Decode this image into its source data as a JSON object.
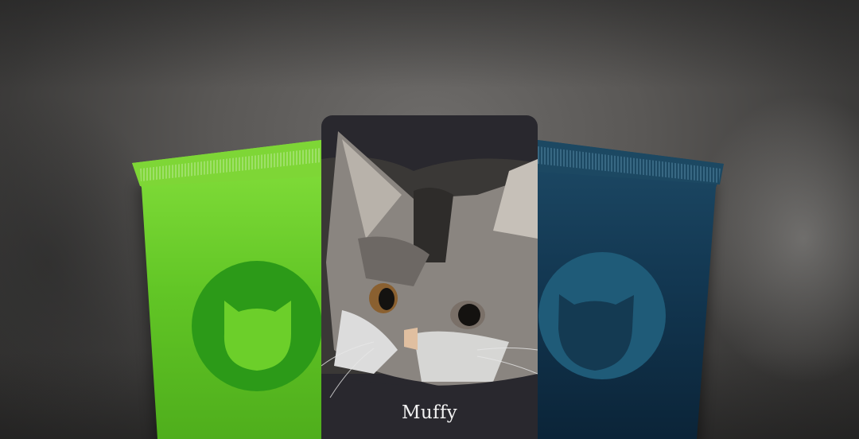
{
  "card": {
    "name": "Muffy"
  },
  "packets": [
    {
      "color": "#6ccf2a",
      "icon": "cat-head-icon"
    },
    {
      "color": "#153a52",
      "icon": "cat-head-icon"
    }
  ]
}
